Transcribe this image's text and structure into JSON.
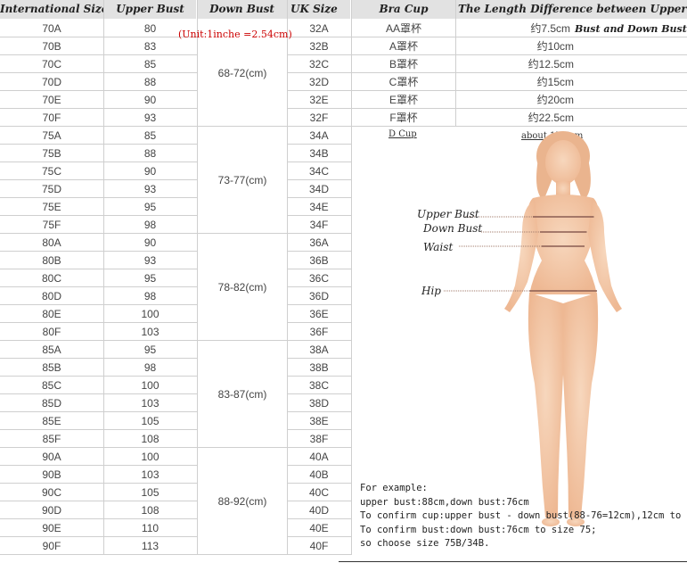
{
  "headers": {
    "international_size": "International Size",
    "upper_bust": "Upper Bust",
    "down_bust": "Down Bust",
    "uk_size": "UK Size",
    "bra_cup": "Bra Cup",
    "length_difference": "The Length Difference between Upper",
    "length_difference_cont": "Bust and Down Bust"
  },
  "unit_note": "(Unit:1inche =2.54cm)",
  "size_rows": [
    {
      "intl": "70A",
      "upper": "80",
      "uk": "32A"
    },
    {
      "intl": "70B",
      "upper": "83",
      "uk": "32B"
    },
    {
      "intl": "70C",
      "upper": "85",
      "uk": "32C"
    },
    {
      "intl": "70D",
      "upper": "88",
      "uk": "32D"
    },
    {
      "intl": "70E",
      "upper": "90",
      "uk": "32E"
    },
    {
      "intl": "70F",
      "upper": "93",
      "uk": "32F"
    },
    {
      "intl": "75A",
      "upper": "85",
      "uk": "34A"
    },
    {
      "intl": "75B",
      "upper": "88",
      "uk": "34B"
    },
    {
      "intl": "75C",
      "upper": "90",
      "uk": "34C"
    },
    {
      "intl": "75D",
      "upper": "93",
      "uk": "34D"
    },
    {
      "intl": "75E",
      "upper": "95",
      "uk": "34E"
    },
    {
      "intl": "75F",
      "upper": "98",
      "uk": "34F"
    },
    {
      "intl": "80A",
      "upper": "90",
      "uk": "36A"
    },
    {
      "intl": "80B",
      "upper": "93",
      "uk": "36B"
    },
    {
      "intl": "80C",
      "upper": "95",
      "uk": "36C"
    },
    {
      "intl": "80D",
      "upper": "98",
      "uk": "36D"
    },
    {
      "intl": "80E",
      "upper": "100",
      "uk": "36E"
    },
    {
      "intl": "80F",
      "upper": "103",
      "uk": "36F"
    },
    {
      "intl": "85A",
      "upper": "95",
      "uk": "38A"
    },
    {
      "intl": "85B",
      "upper": "98",
      "uk": "38B"
    },
    {
      "intl": "85C",
      "upper": "100",
      "uk": "38C"
    },
    {
      "intl": "85D",
      "upper": "103",
      "uk": "38D"
    },
    {
      "intl": "85E",
      "upper": "105",
      "uk": "38E"
    },
    {
      "intl": "85F",
      "upper": "108",
      "uk": "38F"
    },
    {
      "intl": "90A",
      "upper": "100",
      "uk": "40A"
    },
    {
      "intl": "90B",
      "upper": "103",
      "uk": "40B"
    },
    {
      "intl": "90C",
      "upper": "105",
      "uk": "40C"
    },
    {
      "intl": "90D",
      "upper": "108",
      "uk": "40D"
    },
    {
      "intl": "90E",
      "upper": "110",
      "uk": "40E"
    },
    {
      "intl": "90F",
      "upper": "113",
      "uk": "40F"
    }
  ],
  "down_bust_groups": [
    "68-72(cm)",
    "73-77(cm)",
    "78-82(cm)",
    "83-87(cm)",
    "88-92(cm)"
  ],
  "cup_rows": [
    {
      "cup": "AA罩杯",
      "diff": "约7.5cm"
    },
    {
      "cup": "A罩杯",
      "diff": "约10cm"
    },
    {
      "cup": "B罩杯",
      "diff": "约12.5cm"
    },
    {
      "cup": "C罩杯",
      "diff": "约15cm"
    },
    {
      "cup": "E罩杯",
      "diff": "约20cm"
    },
    {
      "cup": "F罩杯",
      "diff": "约22.5cm"
    }
  ],
  "extra_row": {
    "cup": "D Cup",
    "diff": "about 17.5cm"
  },
  "body_labels": {
    "upper_bust": "Upper Bust",
    "down_bust": "Down Bust",
    "waist": "Waist",
    "hip": "Hip"
  },
  "example_lines": [
    "For example:",
    "upper bust:88cm,down bust:76cm",
    "To confirm cup:upper bust - down bust(88-76=12cm),12cm to B c",
    "To confirm bust:down bust:76cm to size 75;",
    "so choose size 75B/34B."
  ],
  "colors": {
    "skin": "#f3c9a8",
    "header_bg": "#e2e2e2",
    "unit_red": "#cc0000"
  }
}
